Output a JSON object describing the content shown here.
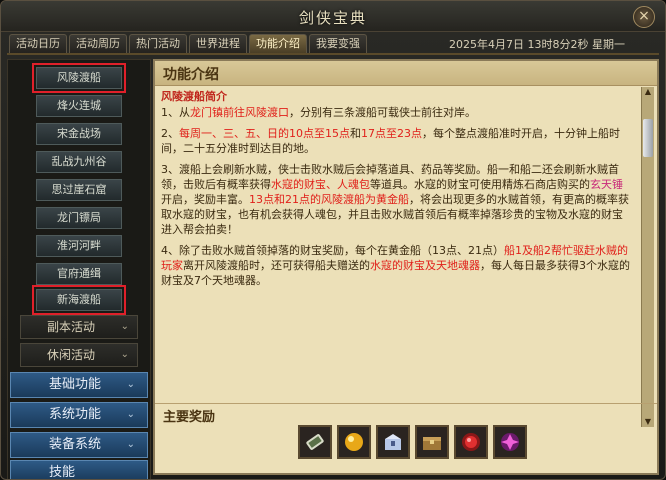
{
  "window": {
    "title": "剑侠宝典",
    "close_label": "×"
  },
  "tabs": [
    {
      "label": "活动日历"
    },
    {
      "label": "活动周历"
    },
    {
      "label": "热门活动"
    },
    {
      "label": "世界进程"
    },
    {
      "label": "功能介绍",
      "active": true
    },
    {
      "label": "我要变强"
    }
  ],
  "datetime": "2025年4月7日  13时8分2秒  星期一",
  "sidebar": {
    "items": [
      {
        "label": "风陵渡船"
      },
      {
        "label": "烽火连城"
      },
      {
        "label": "宋金战场"
      },
      {
        "label": "乱战九州谷"
      },
      {
        "label": "思过崖石窟"
      },
      {
        "label": "龙门镖局"
      },
      {
        "label": "淮河河畔"
      },
      {
        "label": "官府通缉"
      },
      {
        "label": "新海渡船"
      }
    ],
    "categories": [
      {
        "label": "副本活动"
      },
      {
        "label": "休闲活动"
      }
    ],
    "main_categories": [
      {
        "label": "基础功能"
      },
      {
        "label": "系统功能"
      },
      {
        "label": "装备系统"
      },
      {
        "label": "技能"
      }
    ],
    "highlight_color": "#e0201a",
    "chevron": "⌄"
  },
  "content": {
    "title": "功能介绍",
    "subhead": "风陵渡船简介",
    "p1": [
      "1、从",
      "龙门镇前往风陵渡口",
      "，分别有三条渡船可载侠士前往对岸。"
    ],
    "p2": [
      "2、",
      "每周一、三、五、日的",
      "10点至15点",
      "和",
      "17点至23点",
      "，每个整点渡船准时开启，十分钟上船时间，二十五分准时到达目的地。"
    ],
    "p3": [
      "3、渡船上会刷新水贼，侠士击败水贼后会掉落道具、药品等奖励。船一和船二还会刷新水贼首领，击败后有概率获得",
      "水寇的财宝、人魂包",
      "等道具。水寇的财宝可使用精炼石商店购买的",
      "玄天锤",
      "开启，奖励丰富。",
      "13点和21点的风陵渡船为黄金船",
      "，将会出现更多的水贼首领，有更高的概率获取水寇的财宝，也有机会获得人魂包，并且击败水贼首领后有概率掉落珍贵的宝物及水寇的财宝进入帮会拍卖！"
    ],
    "p4": [
      "4、除了击败水贼首领掉落的财宝奖励，每个在黄金船（13点、21点）",
      "船1及船2帮忙驱赶水贼的玩家",
      "离开风陵渡船时，还可获得船夫赠送的",
      "水寇的财宝及天地魂器",
      "，每人每日最多获得3个水寇的财宝及7个天地魂器。"
    ],
    "rewards_title": "主要奖励",
    "rewards": [
      {
        "icon": "scroll-icon"
      },
      {
        "icon": "gold-orb-icon"
      },
      {
        "icon": "blue-chest-icon"
      },
      {
        "icon": "wooden-chest-icon"
      },
      {
        "icon": "red-gem-icon"
      },
      {
        "icon": "purple-gem-icon"
      }
    ]
  }
}
